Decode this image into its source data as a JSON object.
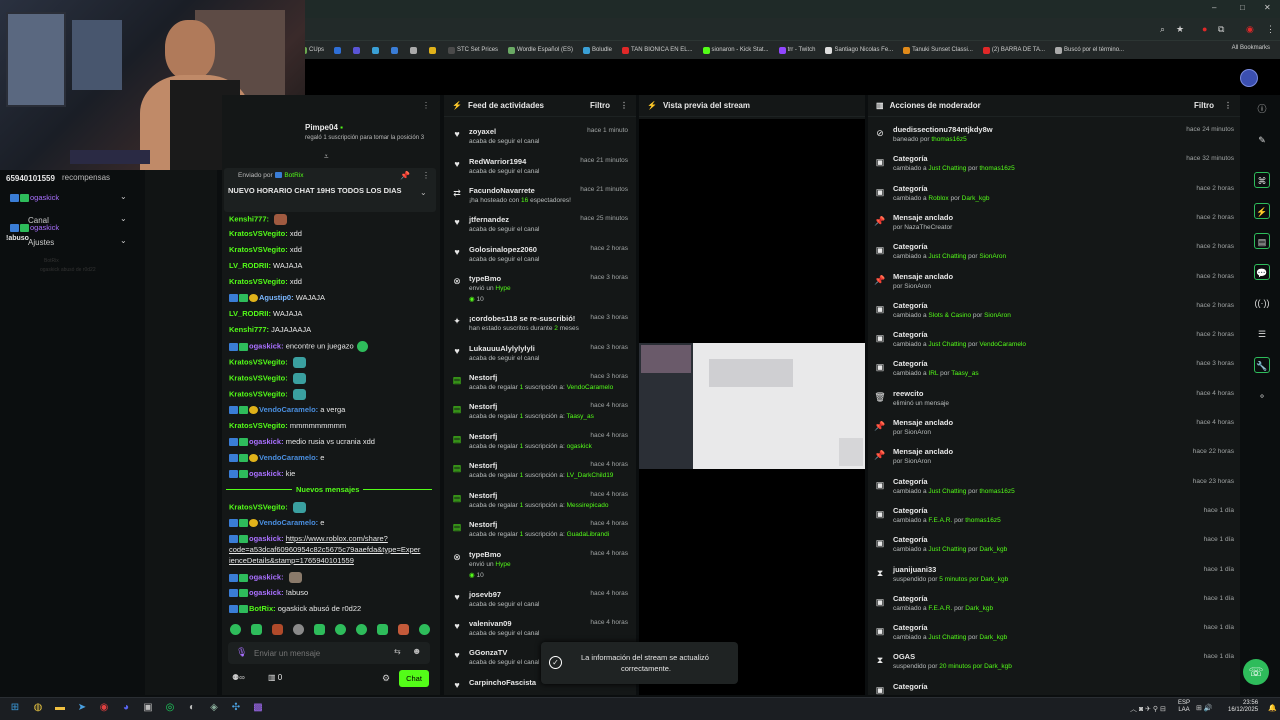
{
  "window": {
    "minimize": "–",
    "maximize": "□",
    "close": "✕"
  },
  "bookmarks": {
    "items": [
      {
        "label": "CUps",
        "color": "#6aa84f"
      },
      {
        "label": "",
        "color": "#2f6fd6"
      },
      {
        "label": "",
        "color": "#5a55d6"
      },
      {
        "label": "",
        "color": "#3aa0d6"
      },
      {
        "label": "",
        "color": "#3a7dd6"
      },
      {
        "label": "",
        "color": "#aaaaaa"
      },
      {
        "label": "",
        "color": "#e0b21a"
      },
      {
        "label": "STC Set Prices",
        "color": "#4a4a4a"
      },
      {
        "label": "Wordle Español (ES)",
        "color": "#6aaa64"
      },
      {
        "label": "Boludle",
        "color": "#3aa0d6"
      },
      {
        "label": "TAN BIONICA EN EL...",
        "color": "#e02828"
      },
      {
        "label": "sionaron - Kick Stat...",
        "color": "#53fc18"
      },
      {
        "label": "trr - Twitch",
        "color": "#9146ff"
      },
      {
        "label": "Santiago Nicolas Fe...",
        "color": "#dddddd"
      },
      {
        "label": "Tanuki Sunset Classi...",
        "color": "#e08a1a"
      },
      {
        "label": "(2) BARRA DE TA...",
        "color": "#e02828"
      },
      {
        "label": "Buscó por el término...",
        "color": "#aaaaaa"
      }
    ],
    "all": "All Bookmarks"
  },
  "streamer": {
    "username": "Pimpe04",
    "sub_info": "regaló 1 suscripción para tomar la posición 3"
  },
  "left_menu": {
    "id_text": "65940101559",
    "recompensas": "recompensas",
    "user1": "ogaskick",
    "canal": "Canal",
    "user2": "ogaskick",
    "ajustes": "Ajustes",
    "abuso": "!abuso",
    "ghost1": "BotRix",
    "ghost2": "ogaskick abusó de r0d22"
  },
  "chat": {
    "pinned": {
      "by_label": "Enviado por",
      "by_user": "BotRix",
      "message": "NUEVO HORARIO CHAT 19HS TODOS LOS DIAS"
    },
    "lines": [
      {
        "user": "Kenshi777:",
        "text": ""
      },
      {
        "user": "KratosVSVegito:",
        "text": "xdd"
      },
      {
        "user": "KratosVSVegito:",
        "text": "xdd"
      },
      {
        "user": "LV_RODRII:",
        "text": "WAJAJA"
      },
      {
        "user": "KratosVSVegito:",
        "text": "xdd"
      },
      {
        "user": "Agustip0:",
        "text": "WAJAJA"
      },
      {
        "user": "LV_RODRII:",
        "text": "WAJAJA"
      },
      {
        "user": "Kenshi777:",
        "text": "JAJAJAAJA"
      },
      {
        "user": "ogaskick:",
        "text": "encontre un juegazo"
      },
      {
        "user": "KratosVSVegito:",
        "text": ""
      },
      {
        "user": "KratosVSVegito:",
        "text": ""
      },
      {
        "user": "KratosVSVegito:",
        "text": ""
      },
      {
        "user": "VendoCaramelo:",
        "text": "a verga"
      },
      {
        "user": "KratosVSVegito:",
        "text": "mmmmmmmmm"
      },
      {
        "user": "ogaskick:",
        "text": "medio rusia vs ucrania xdd"
      },
      {
        "user": "VendoCaramelo:",
        "text": "e"
      },
      {
        "user": "ogaskick:",
        "text": "kie"
      }
    ],
    "new_messages": "Nuevos mensajes",
    "lines2": [
      {
        "user": "KratosVSVegito:",
        "text": ""
      },
      {
        "user": "VendoCaramelo:",
        "text": "e"
      },
      {
        "user": "ogaskick:",
        "text": "https://www.roblox.com/share?",
        "text2": "code=a53dcaf60960954c82c5675c79aaefda&type=Exper",
        "text3": "ienceDetails&stamp=1765940101559"
      },
      {
        "user": "ogaskick:",
        "text": ""
      },
      {
        "user": "ogaskick:",
        "text": "!abuso"
      },
      {
        "user": "BotRix:",
        "text": "ogaskick abusó de r0d22"
      }
    ],
    "input_placeholder": "Enviar un mensaje",
    "viewers": "0",
    "send_label": "Chat"
  },
  "feed": {
    "title": "Feed de actividades",
    "filter": "Filtro",
    "items": [
      {
        "name": "zoyaxel",
        "desc": "acaba de seguir el canal",
        "time": "hace 1 minuto",
        "icon": "♥"
      },
      {
        "name": "RedWarrior1994",
        "desc": "acaba de seguir el canal",
        "time": "hace 21 minutos",
        "icon": "♥"
      },
      {
        "name": "FacundoNavarrete",
        "desc": "¡ha hosteado con 16 espectadores!",
        "time": "hace 21 minutos",
        "icon": "⇄"
      },
      {
        "name": "jtfernandez",
        "desc": "acaba de seguir el canal",
        "time": "hace 25 minutos",
        "icon": "♥"
      },
      {
        "name": "Golosinalopez2060",
        "desc": "acaba de seguir el canal",
        "time": "hace 2 horas",
        "icon": "♥"
      },
      {
        "name": "typeBmo",
        "desc": "envió un Hype",
        "extra": "10",
        "time": "hace 3 horas",
        "icon": "⊗"
      },
      {
        "name": "¡cordobes118 se re-suscribió!",
        "desc": "han estado suscritos durante 2 meses",
        "time": "hace 3 horas",
        "icon": "✦"
      },
      {
        "name": "LukauuuAlylylylyli",
        "desc": "acaba de seguir el canal",
        "time": "hace 3 horas",
        "icon": "♥"
      },
      {
        "name": "Nestorfj",
        "desc": "acaba de regalar 1 suscripción a: VendoCaramelo",
        "time": "hace 3 horas",
        "icon": "▤"
      },
      {
        "name": "Nestorfj",
        "desc": "acaba de regalar 1 suscripción a: Taasy_as",
        "time": "hace 4 horas",
        "icon": "▤"
      },
      {
        "name": "Nestorfj",
        "desc": "acaba de regalar 1 suscripción a: ogaskick",
        "time": "hace 4 horas",
        "icon": "▤"
      },
      {
        "name": "Nestorfj",
        "desc": "acaba de regalar 1 suscripción a: LV_DarkChild19",
        "time": "hace 4 horas",
        "icon": "▤"
      },
      {
        "name": "Nestorfj",
        "desc": "acaba de regalar 1 suscripción a: Messirepicado",
        "time": "hace 4 horas",
        "icon": "▤"
      },
      {
        "name": "Nestorfj",
        "desc": "acaba de regalar 1 suscripción a: GuadaLibrandi",
        "time": "hace 4 horas",
        "icon": "▤"
      },
      {
        "name": "typeBmo",
        "desc": "envió un Hype",
        "extra": "10",
        "time": "hace 4 horas",
        "icon": "⊗"
      },
      {
        "name": "josevb97",
        "desc": "acaba de seguir el canal",
        "time": "hace 4 horas",
        "icon": "♥"
      },
      {
        "name": "valenivan09",
        "desc": "acaba de seguir el canal",
        "time": "hace 4 horas",
        "icon": "♥"
      },
      {
        "name": "GGonzaTV",
        "desc": "acaba de seguir el canal",
        "time": "",
        "icon": "♥"
      },
      {
        "name": "CarpinchoFascista",
        "desc": "",
        "time": "",
        "icon": "♥"
      }
    ]
  },
  "preview": {
    "title": "Vista previa del stream"
  },
  "toast": {
    "text1": "La información del stream se actualizó",
    "text2": "correctamente."
  },
  "mod": {
    "title": "Acciones de moderador",
    "filter": "Filtro",
    "items": [
      {
        "title": "duedissectionu784ntjkdy8w",
        "desc": "baneado por thomas16z5",
        "time": "hace 24 minutos",
        "icon": "⊘"
      },
      {
        "title": "Categoría",
        "desc": "cambiado a Just Chatting por thomas16z5",
        "time": "hace 32 minutos",
        "icon": "▣"
      },
      {
        "title": "Categoría",
        "desc": "cambiado a Roblox por Dark_kgb",
        "time": "hace 2 horas",
        "icon": "▣"
      },
      {
        "title": "Mensaje anclado",
        "desc": "por NazaTheCreator",
        "time": "hace 2 horas",
        "icon": "📌"
      },
      {
        "title": "Categoría",
        "desc": "cambiado a Just Chatting por SionAron",
        "time": "hace 2 horas",
        "icon": "▣"
      },
      {
        "title": "Mensaje anclado",
        "desc": "por SionAron",
        "time": "hace 2 horas",
        "icon": "📌"
      },
      {
        "title": "Categoría",
        "desc": "cambiado a Slots & Casino por SionAron",
        "time": "hace 2 horas",
        "icon": "▣"
      },
      {
        "title": "Categoría",
        "desc": "cambiado a Just Chatting por VendoCaramelo",
        "time": "hace 2 horas",
        "icon": "▣"
      },
      {
        "title": "Categoría",
        "desc": "cambiado a IRL por Taasy_as",
        "time": "hace 3 horas",
        "icon": "▣"
      },
      {
        "title": "reewcito",
        "desc": "eliminó un mensaje",
        "time": "hace 4 horas",
        "icon": "🗑"
      },
      {
        "title": "Mensaje anclado",
        "desc": "por SionAron",
        "time": "hace 4 horas",
        "icon": "📌"
      },
      {
        "title": "Mensaje anclado",
        "desc": "por SionAron",
        "time": "hace 22 horas",
        "icon": "📌"
      },
      {
        "title": "Categoría",
        "desc": "cambiado a Just Chatting por thomas16z5",
        "time": "hace 23 horas",
        "icon": "▣"
      },
      {
        "title": "Categoría",
        "desc": "cambiado a F.E.A.R. por thomas16z5",
        "time": "hace 1 día",
        "icon": "▣"
      },
      {
        "title": "Categoría",
        "desc": "cambiado a Just Chatting por Dark_kgb",
        "time": "hace 1 día",
        "icon": "▣"
      },
      {
        "title": "juanijuani33",
        "desc": "suspendido por 5 minutos por Dark_kgb",
        "time": "hace 1 día",
        "icon": "⧗"
      },
      {
        "title": "Categoría",
        "desc": "cambiado a F.E.A.R. por Dark_kgb",
        "time": "hace 1 día",
        "icon": "▣"
      },
      {
        "title": "Categoría",
        "desc": "cambiado a Just Chatting por Dark_kgb",
        "time": "hace 1 día",
        "icon": "▣"
      },
      {
        "title": "OGAS",
        "desc": "suspendido por 20 minutos por Dark_kgb",
        "time": "hace 1 día",
        "icon": "⧗"
      },
      {
        "title": "Categoría",
        "desc": "",
        "time": "",
        "icon": "▣"
      }
    ]
  },
  "taskbar": {
    "lang1": "ESP",
    "lang2": "LAA",
    "time": "23:56",
    "date": "16/12/2025"
  },
  "colors": {
    "kick_green": "#53fc18",
    "bg": "#0b0e0f",
    "panel": "#141717"
  }
}
